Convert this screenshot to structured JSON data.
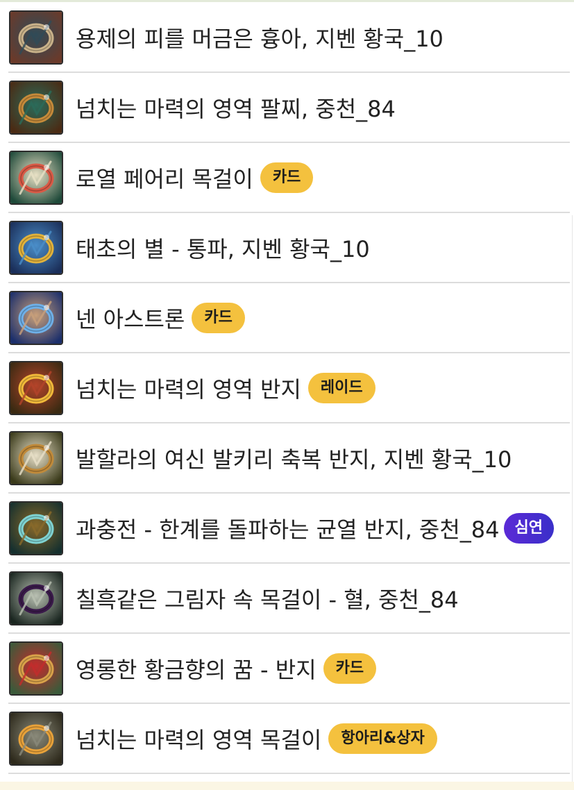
{
  "items": [
    {
      "name": "용제의 피를 머금은 흉아, 지벤 황국_10",
      "badge": "",
      "icon": "claw-icon",
      "palette": [
        "#6b3a2a",
        "#c9b28a",
        "#2f4b58"
      ]
    },
    {
      "name": "넘치는 마력의 영역 팔찌, 중천_84",
      "badge": "",
      "icon": "bracelet-icon",
      "palette": [
        "#4a2b14",
        "#c58a3a",
        "#2b6b5a"
      ]
    },
    {
      "name": "로열 페어리 목걸이",
      "badge": "카드",
      "icon": "flower-necklace-icon",
      "palette": [
        "#1f4a3a",
        "#d85a46",
        "#e9e1c5"
      ]
    },
    {
      "name": "태초의 별 - 통파, 지벤 황국_10",
      "badge": "",
      "icon": "star-staff-icon",
      "palette": [
        "#1b2f5a",
        "#e1b23c",
        "#4a8ec9"
      ]
    },
    {
      "name": "넨 아스트론",
      "badge": "카드",
      "icon": "astron-icon",
      "palette": [
        "#1c2f6b",
        "#6fb0e8",
        "#c9a07a"
      ]
    },
    {
      "name": "넘치는 마력의 영역 반지",
      "badge": "레이드",
      "icon": "gold-ring-icon",
      "palette": [
        "#3a2a12",
        "#f1b93a",
        "#b4442a"
      ]
    },
    {
      "name": "발할라의 여신 발키리 축복 반지, 지벤 황국_10",
      "badge": "",
      "icon": "wing-ring-icon",
      "palette": [
        "#3a3a1a",
        "#c08a3a",
        "#e8e0c8"
      ]
    },
    {
      "name": "과충전 - 한계를 돌파하는 균열 반지, 중천_84",
      "badge": "심연",
      "badge_style": "purple",
      "icon": "crack-ring-icon",
      "palette": [
        "#16302e",
        "#7fd3d2",
        "#8a6a2a"
      ]
    },
    {
      "name": "칠흑같은 그림자 속 목걸이 - 혈, 중천_84",
      "badge": "",
      "icon": "shadow-necklace-icon",
      "palette": [
        "#1a2620",
        "#3a1a4a",
        "#b9c0b2"
      ]
    },
    {
      "name": "영롱한 황금향의 꿈 - 반지",
      "badge": "카드",
      "icon": "ruby-ring-icon",
      "palette": [
        "#3b5a3a",
        "#d9a24a",
        "#c42c2c"
      ]
    },
    {
      "name": "넘치는 마력의 영역 목걸이",
      "badge": "항아리&상자",
      "icon": "horn-necklace-icon",
      "palette": [
        "#2e2a1c",
        "#e8a23a",
        "#8a8a7a"
      ]
    }
  ],
  "colors": {
    "badge_yellow": "#f4c13e",
    "badge_purple": "#4a2ccf",
    "divider": "#dcdcdc",
    "text": "#222222"
  }
}
